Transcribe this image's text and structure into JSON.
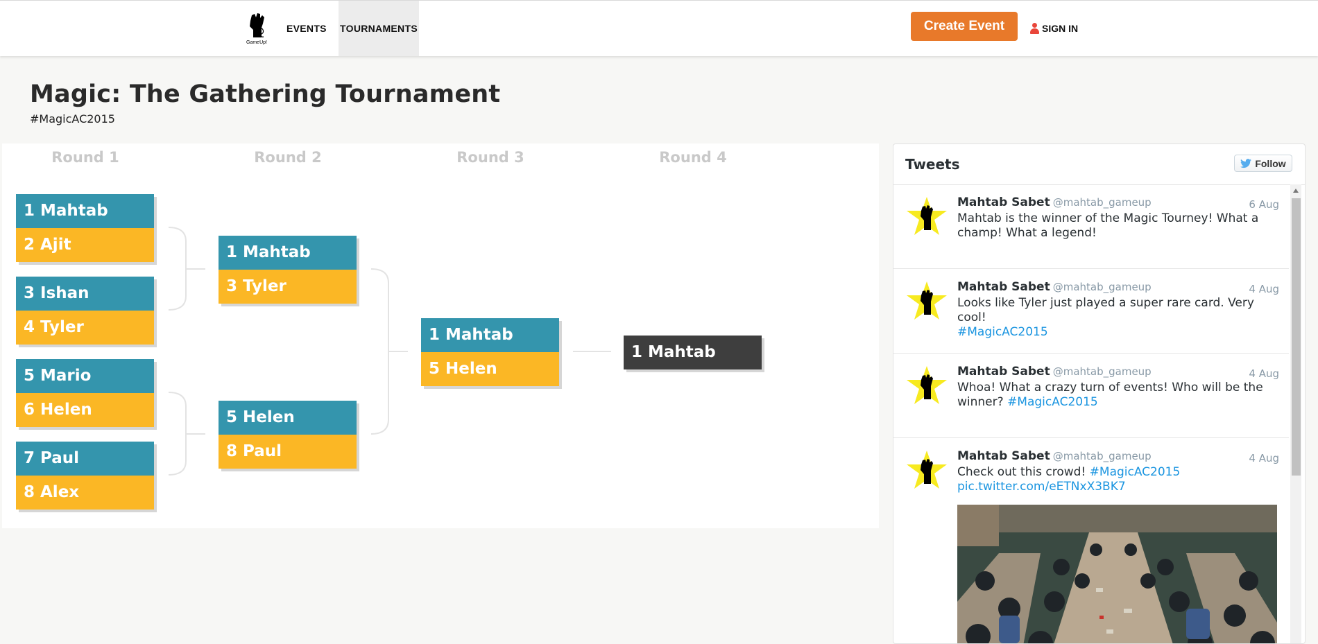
{
  "header": {
    "logo_text": "GameUp!",
    "nav": {
      "events": "EVENTS",
      "tournaments": "TOURNAMENTS"
    },
    "create_event": "Create Event",
    "sign_in": "SIGN IN"
  },
  "page": {
    "title": "Magic: The Gathering Tournament",
    "hashtag": "#MagicAC2015"
  },
  "bracket": {
    "rounds": [
      "Round 1",
      "Round 2",
      "Round 3",
      "Round 4"
    ],
    "round1": [
      {
        "top": "1 Mahtab",
        "bottom": "2 Ajit"
      },
      {
        "top": "3 Ishan",
        "bottom": "4 Tyler"
      },
      {
        "top": "5 Mario",
        "bottom": "6 Helen"
      },
      {
        "top": "7 Paul",
        "bottom": "8 Alex"
      }
    ],
    "round2": [
      {
        "top": "1 Mahtab",
        "bottom": "3 Tyler"
      },
      {
        "top": "5 Helen",
        "bottom": "8 Paul"
      }
    ],
    "round3": [
      {
        "top": "1 Mahtab",
        "bottom": "5 Helen"
      }
    ],
    "winner": "1 Mahtab"
  },
  "tweets": {
    "title": "Tweets",
    "follow": "Follow",
    "items": [
      {
        "author": "Mahtab Sabet",
        "handle": "@mahtab_gameup",
        "date": "6 Aug",
        "text": "Mahtab is the winner of the Magic Tourney! What a champ! What a legend!",
        "link": ""
      },
      {
        "author": "Mahtab Sabet",
        "handle": "@mahtab_gameup",
        "date": "4 Aug",
        "text": "Looks like Tyler just played a super rare card. Very cool!",
        "link": "#MagicAC2015"
      },
      {
        "author": "Mahtab Sabet",
        "handle": "@mahtab_gameup",
        "date": "4 Aug",
        "text": "Whoa! What a crazy turn of events! Who will be the winner?",
        "link": "#MagicAC2015"
      },
      {
        "author": "Mahtab Sabet",
        "handle": "@mahtab_gameup",
        "date": "4 Aug",
        "text": "Check out this crowd!",
        "link": "#MagicAC2015",
        "link2": "pic.twitter.com/eETNxX3BK7"
      }
    ]
  },
  "colors": {
    "accent_orange": "#e8792a",
    "slot_blue": "#3495ad",
    "slot_yellow": "#fbb725",
    "winner_dark": "#3e3e3e",
    "link_blue": "#1b95e0"
  }
}
